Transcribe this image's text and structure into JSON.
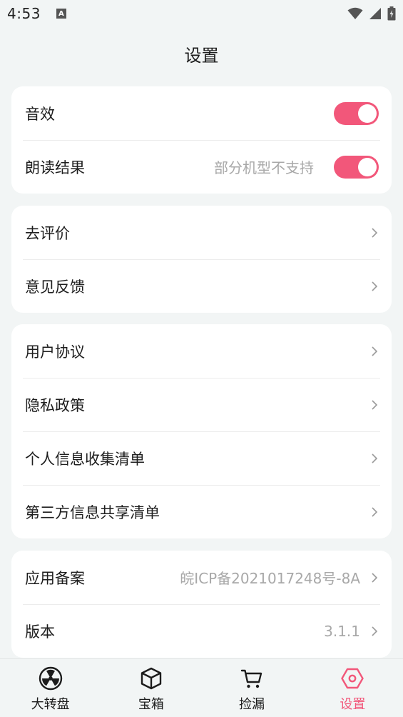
{
  "status_bar": {
    "time": "4:53",
    "notification_letter": "A"
  },
  "header": {
    "title": "设置"
  },
  "sections": [
    {
      "items": [
        {
          "label": "音效",
          "toggle_on": true
        },
        {
          "label": "朗读结果",
          "value": "部分机型不支持",
          "toggle_on": true
        }
      ]
    },
    {
      "items": [
        {
          "label": "去评价"
        },
        {
          "label": "意见反馈"
        }
      ]
    },
    {
      "items": [
        {
          "label": "用户协议"
        },
        {
          "label": "隐私政策"
        },
        {
          "label": "个人信息收集清单"
        },
        {
          "label": "第三方信息共享清单"
        }
      ]
    },
    {
      "items": [
        {
          "label": "应用备案",
          "value": "皖ICP备2021017248号-8A"
        },
        {
          "label": "版本",
          "value": "3.1.1"
        }
      ]
    }
  ],
  "tabs": [
    {
      "label": "大转盘",
      "icon": "wheel-icon"
    },
    {
      "label": "宝箱",
      "icon": "box-icon"
    },
    {
      "label": "捡漏",
      "icon": "cart-icon"
    },
    {
      "label": "设置",
      "icon": "hexagon-settings-icon",
      "active": true
    }
  ],
  "colors": {
    "accent": "#f2577a",
    "background": "#f2f5f5",
    "card": "#ffffff",
    "muted_text": "#a8a8a8"
  }
}
